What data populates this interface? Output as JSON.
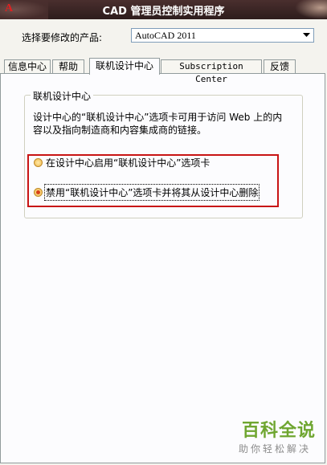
{
  "window": {
    "title": "CAD 管理员控制实用程序",
    "app_icon": "A"
  },
  "product": {
    "label": "选择要修改的产品:",
    "selected": "AutoCAD 2011"
  },
  "tabs": [
    {
      "label": "信息中心",
      "active": false
    },
    {
      "label": "帮助",
      "active": false
    },
    {
      "label": "联机设计中心",
      "active": true
    },
    {
      "label": "Subscription Center",
      "active": false
    },
    {
      "label": "反馈",
      "active": false
    }
  ],
  "group": {
    "title": "联机设计中心",
    "description": "设计中心的“联机设计中心”选项卡可用于访问 Web 上的内容以及指向制造商和内容集成商的链接。"
  },
  "options": [
    {
      "label": "在设计中心启用“联机设计中心”选项卡",
      "selected": false
    },
    {
      "label": "禁用“联机设计中心”选项卡并将其从设计中心删除",
      "selected": true
    }
  ],
  "watermark": {
    "brand": "百科全说",
    "slogan": "助你轻松解决"
  },
  "colors": {
    "highlight": "#c81414",
    "watermark_brand": "#6fa630"
  }
}
